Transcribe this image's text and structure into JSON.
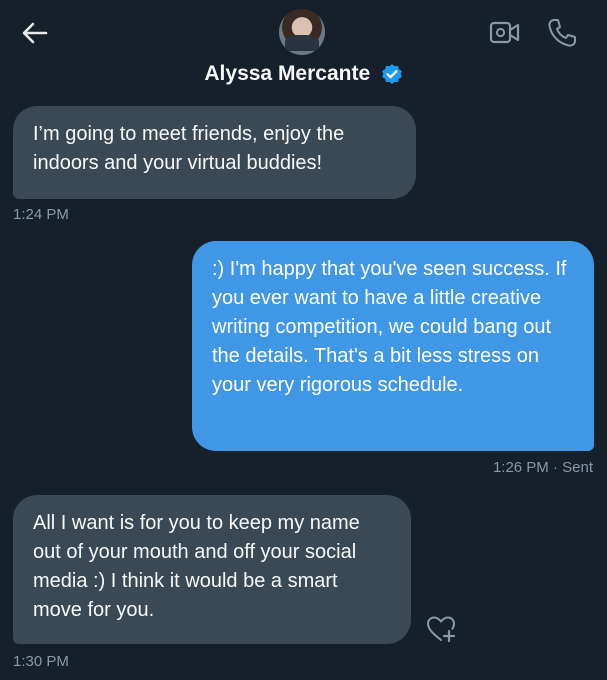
{
  "header": {
    "contact_name": "Alyssa Mercante",
    "verified": true,
    "accent_color": "#1d9bf0"
  },
  "messages": [
    {
      "direction": "incoming",
      "text": "I’m going to meet friends, enjoy the indoors and your virtual buddies!",
      "time": "1:24 PM"
    },
    {
      "direction": "outgoing",
      "text": ":) I'm happy that you've seen success. If you ever want to have a little creative writing competition, we could bang out the details. That's a bit less stress on your very rigorous schedule.",
      "time": "1:26 PM · Sent"
    },
    {
      "direction": "incoming",
      "text": "All I want is for you to keep my name out of your mouth and off your social media :) I think it would be a smart move for you.",
      "time": "1:30 PM"
    }
  ],
  "icons": {
    "back": "arrow-left-icon",
    "video": "video-camera-icon",
    "call": "phone-icon",
    "react": "heart-plus-icon"
  }
}
